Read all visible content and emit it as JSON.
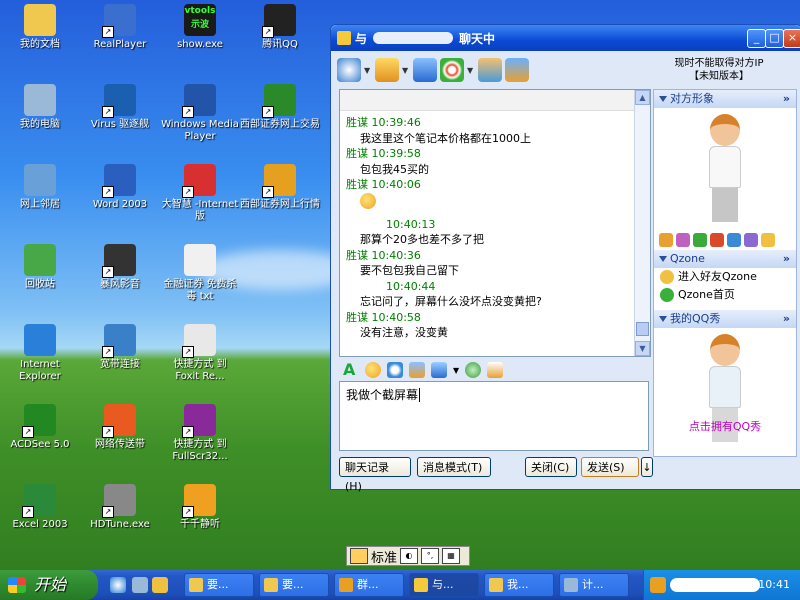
{
  "desktop": {
    "icons": [
      {
        "label": "我的文档",
        "icon": "folder-documents-icon",
        "color": "#f0c850",
        "shortcut": false
      },
      {
        "label": "RealPlayer",
        "icon": "realplayer-icon",
        "color": "#3a6fd0",
        "shortcut": true
      },
      {
        "label": "show.exe",
        "icon": "vtools-show-icon",
        "color": "#1a1a1a",
        "shortcut": false,
        "badge": "vtools 示波"
      },
      {
        "label": "腾讯QQ",
        "icon": "qq-penguin-icon",
        "color": "#222222",
        "shortcut": true
      },
      {
        "label": "我的电脑",
        "icon": "my-computer-icon",
        "color": "#9ab8d8",
        "shortcut": false
      },
      {
        "label": "Virus 驱逐舰",
        "icon": "virus-shield-icon",
        "color": "#1a5fb0",
        "shortcut": true
      },
      {
        "label": "Windows Media Player",
        "icon": "media-player-icon",
        "color": "#2255aa",
        "shortcut": true
      },
      {
        "label": "西部证券网上交易",
        "icon": "stock-trade-icon",
        "color": "#2a8a2a",
        "shortcut": true
      },
      {
        "label": "网上邻居",
        "icon": "network-places-icon",
        "color": "#6aa0d8",
        "shortcut": false
      },
      {
        "label": "Word 2003",
        "icon": "word-icon",
        "color": "#2a5fc0",
        "shortcut": true
      },
      {
        "label": "大智慧 -Internet版",
        "icon": "dazhihui-icon",
        "color": "#d83030",
        "shortcut": true
      },
      {
        "label": "西部证券网上行情",
        "icon": "stock-quote-icon",
        "color": "#e6a020",
        "shortcut": true
      },
      {
        "label": "回收站",
        "icon": "recycle-bin-icon",
        "color": "#48a848",
        "shortcut": false
      },
      {
        "label": "暴风影音",
        "icon": "storm-player-icon",
        "color": "#333333",
        "shortcut": true
      },
      {
        "label": "金融证券 免费杀毒 txt",
        "icon": "text-file-icon",
        "color": "#f0f0f0",
        "shortcut": false
      },
      {
        "label": "Internet Explorer",
        "icon": "ie-icon",
        "color": "#2a7fd8",
        "shortcut": false
      },
      {
        "label": "宽带连接",
        "icon": "broadband-icon",
        "color": "#3a80c8",
        "shortcut": true
      },
      {
        "label": "快捷方式 到 Foxit Re...",
        "icon": "foxit-reader-icon",
        "color": "#e8e8e8",
        "shortcut": true
      },
      {
        "label": "ACDSee 5.0",
        "icon": "acdsee-icon",
        "color": "#228822",
        "shortcut": true
      },
      {
        "label": "网络传送带",
        "icon": "transfer-icon",
        "color": "#e85a20",
        "shortcut": true
      },
      {
        "label": "快捷方式 到 FullScr32...",
        "icon": "fullscreen-icon",
        "color": "#8a2a9a",
        "shortcut": true
      },
      {
        "label": "Excel 2003",
        "icon": "excel-icon",
        "color": "#2a8a3a",
        "shortcut": true
      },
      {
        "label": "HDTune.exe",
        "icon": "hdtune-icon",
        "color": "#888888",
        "shortcut": true
      },
      {
        "label": "千千静听",
        "icon": "ttplayer-icon",
        "color": "#f0a020",
        "shortcut": true
      }
    ]
  },
  "chat": {
    "title_prefix": "与",
    "title_suffix": "聊天中",
    "ip_line1": "现时不能取得对方IP",
    "ip_line2": "【未知版本】",
    "messages": [
      {
        "type": "sender",
        "text": "胜谋 10:39:46"
      },
      {
        "type": "content",
        "text": "我这里这个笔记本价格都在1000上"
      },
      {
        "type": "sender",
        "text": "胜谋 10:39:58"
      },
      {
        "type": "content",
        "text": "包包我45买的"
      },
      {
        "type": "sender",
        "text": "胜谋 10:40:06"
      },
      {
        "type": "smiley",
        "text": ""
      },
      {
        "type": "sender",
        "text": "10:40:13"
      },
      {
        "type": "content",
        "text": "那算个20多也差不多了把"
      },
      {
        "type": "sender",
        "text": "胜谋 10:40:36"
      },
      {
        "type": "content",
        "text": "要不包包我自己留下"
      },
      {
        "type": "sender",
        "text": "10:40:44"
      },
      {
        "type": "content",
        "text": "忘记问了，屏幕什么没坏点没变黄把?"
      },
      {
        "type": "sender",
        "text": "胜谋 10:40:58"
      },
      {
        "type": "content",
        "text": "没有注意，没变黄"
      }
    ],
    "input_text": "我做个截屏幕",
    "buttons": {
      "history": "聊天记录(H)",
      "mode": "消息模式(T)",
      "close": "关闭(C)",
      "send": "发送(S)",
      "send_arrow": "↓"
    },
    "side": {
      "avatar_header": "对方形象",
      "qzone_header": "Qzone",
      "qzone_items": [
        "进入好友Qzone",
        "Qzone首页"
      ],
      "qqshow_header": "我的QQ秀",
      "qqshow_link": "点击拥有QQ秀"
    }
  },
  "ime": {
    "label": "标准"
  },
  "taskbar": {
    "start_label": "开始",
    "tasks": [
      {
        "label": "要...",
        "icon": "folder-icon",
        "color": "#f0c850"
      },
      {
        "label": "要...",
        "icon": "folder-icon",
        "color": "#f0c850"
      },
      {
        "label": "群...",
        "icon": "qq-group-icon",
        "color": "#e8a020"
      },
      {
        "label": "与...",
        "icon": "qq-chat-icon",
        "color": "#f4c93a"
      },
      {
        "label": "我...",
        "icon": "folder-icon",
        "color": "#f0c850"
      },
      {
        "label": "计...",
        "icon": "computer-icon",
        "color": "#9ab8d8"
      }
    ],
    "clock": "10:41"
  }
}
